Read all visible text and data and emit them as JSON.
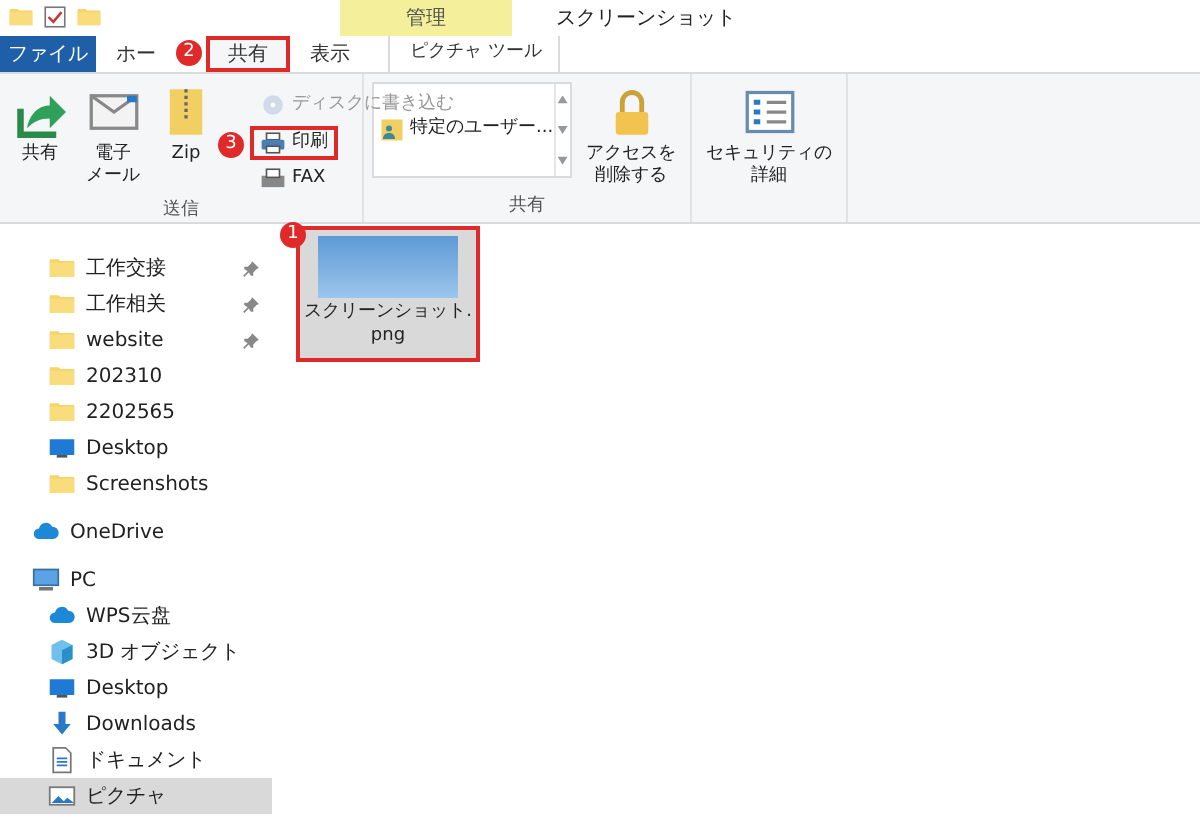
{
  "title_bar": {
    "context_group": "管理",
    "title": "スクリーンショット"
  },
  "tabs": [
    {
      "label": "ファイル",
      "kind": "file",
      "selected": false,
      "highlighted": false
    },
    {
      "label": "ホー",
      "kind": "normal",
      "selected": false,
      "highlighted": false
    },
    {
      "label": "共有",
      "kind": "normal",
      "selected": true,
      "highlighted": true,
      "annotation": "2"
    },
    {
      "label": "表示",
      "kind": "normal",
      "selected": false,
      "highlighted": false
    },
    {
      "label": "ピクチャ ツール",
      "kind": "context",
      "selected": false,
      "highlighted": false
    }
  ],
  "ribbon_groups": [
    {
      "label": "送信",
      "items": [
        {
          "kind": "large",
          "lines": [
            "共有"
          ]
        },
        {
          "kind": "large",
          "lines": [
            "電子",
            "メール"
          ]
        },
        {
          "kind": "large",
          "lines": [
            "Zip"
          ]
        },
        {
          "kind": "stack",
          "buttons": [
            {
              "label": "ディスクに書き込む",
              "disabled": true,
              "highlighted": false
            },
            {
              "label": "印刷",
              "disabled": false,
              "highlighted": true,
              "annotation": "3"
            },
            {
              "label": "FAX",
              "disabled": false,
              "highlighted": false
            }
          ]
        }
      ]
    },
    {
      "label": "共有",
      "items": [
        {
          "kind": "gallery",
          "entries": [
            "特定のユーザー..."
          ]
        },
        {
          "kind": "large",
          "lines": [
            "アクセスを",
            "削除する"
          ]
        }
      ]
    },
    {
      "items": [
        {
          "kind": "large",
          "lines": [
            "セキュリティの",
            "詳細"
          ]
        }
      ]
    }
  ],
  "nav": {
    "quick_access": [
      {
        "label": "工作交接",
        "kind": "folder",
        "pinned": true,
        "selected": false
      },
      {
        "label": "工作相关",
        "kind": "folder",
        "pinned": true,
        "selected": false
      },
      {
        "label": "website",
        "kind": "folder",
        "pinned": true,
        "selected": false
      },
      {
        "label": "202310",
        "kind": "folder",
        "pinned": false,
        "selected": false
      },
      {
        "label": "2202565",
        "kind": "folder",
        "pinned": false,
        "selected": false
      },
      {
        "label": "Desktop",
        "kind": "desktop",
        "pinned": false,
        "selected": false
      },
      {
        "label": "Screenshots",
        "kind": "folder",
        "pinned": false,
        "selected": false
      }
    ],
    "roots": [
      {
        "label": "OneDrive",
        "kind": "cloud",
        "selected": false
      },
      {
        "label": "PC",
        "kind": "pc",
        "selected": false,
        "children": [
          {
            "label": "WPS云盘",
            "kind": "cloud",
            "selected": false
          },
          {
            "label": "3D オブジェクト",
            "kind": "cube",
            "selected": false
          },
          {
            "label": "Desktop",
            "kind": "desktop",
            "selected": false
          },
          {
            "label": "Downloads",
            "kind": "download",
            "selected": false
          },
          {
            "label": "ドキュメント",
            "kind": "document",
            "selected": false
          },
          {
            "label": "ピクチャ",
            "kind": "pictures",
            "selected": true
          }
        ]
      }
    ]
  },
  "files": [
    {
      "lines": [
        "スクリーンショット.",
        "png"
      ],
      "selected": true,
      "highlighted": true,
      "annotation": "1"
    }
  ]
}
